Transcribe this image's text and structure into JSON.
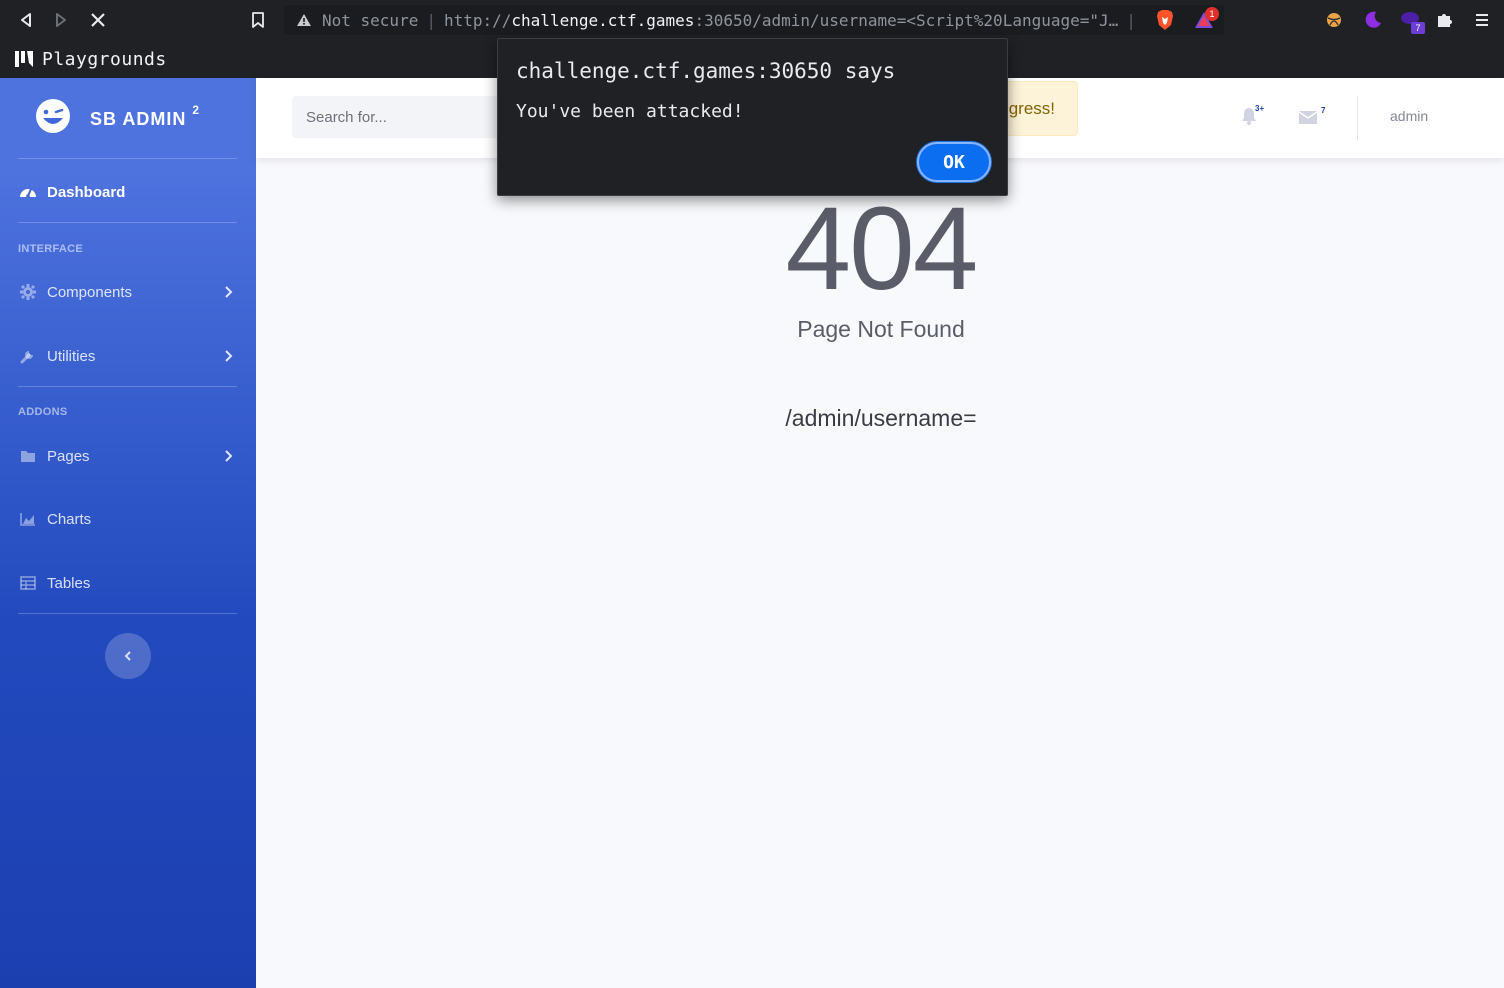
{
  "browser": {
    "security_label": "Not secure",
    "url_scheme": "http://",
    "url_host": "challenge.ctf.games",
    "url_rest": ":30650/admin/username=<Script%20Language=\"J…",
    "bookmark_label": "Playgrounds",
    "brave_badge": "1",
    "ext_badge": "7"
  },
  "sidebar": {
    "brand": "SB ADMIN",
    "brand_sup": "2",
    "dashboard": "Dashboard",
    "section_interface": "INTERFACE",
    "section_addons": "ADDONS",
    "items": {
      "components": "Components",
      "utilities": "Utilities",
      "pages": "Pages",
      "charts": "Charts",
      "tables": "Tables"
    }
  },
  "topbar": {
    "search_placeholder": "Search for...",
    "alert_text": "gress!",
    "alerts_badge": "3+",
    "messages_badge": "7",
    "user_name": "admin"
  },
  "main": {
    "error_code": "404",
    "error_text": "Page Not Found",
    "error_path": "/admin/username="
  },
  "dialog": {
    "title": "challenge.ctf.games:30650 says",
    "message": "You've been attacked!",
    "ok_label": "OK"
  }
}
